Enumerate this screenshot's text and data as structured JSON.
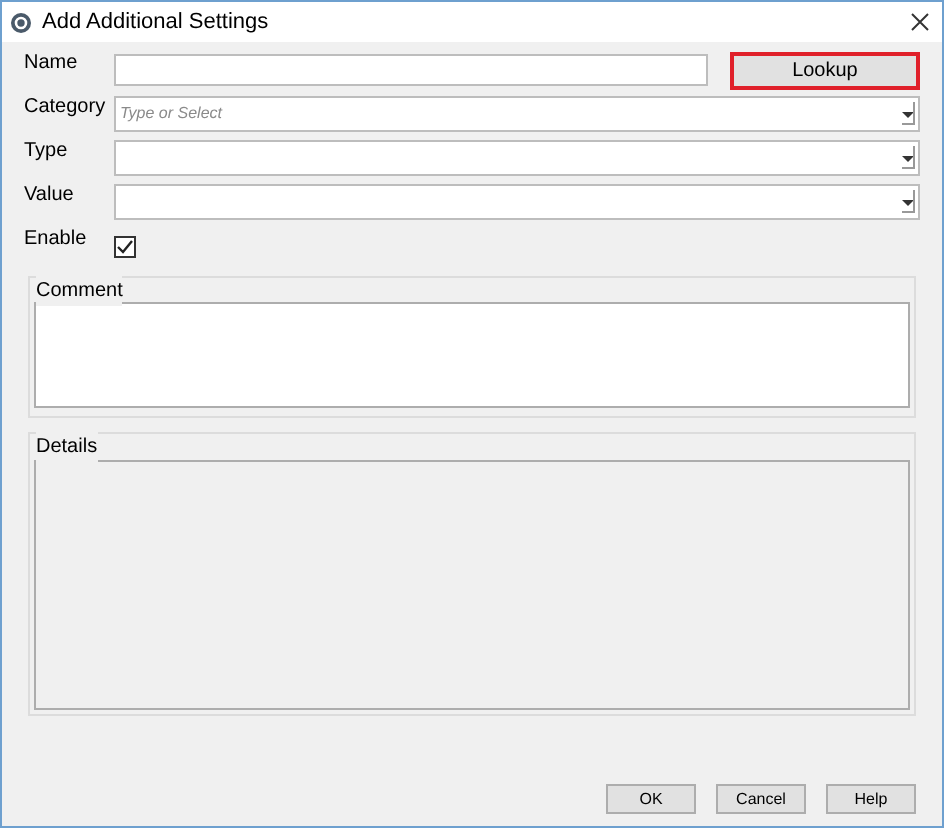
{
  "window": {
    "title": "Add Additional Settings"
  },
  "fields": [
    {
      "kind": "text",
      "label": "Name",
      "button": {
        "label": "Lookup",
        "focused": true
      }
    },
    {
      "kind": "combo",
      "label": "Category",
      "placeholder": "Type or Select"
    },
    {
      "kind": "combo",
      "label": "Type"
    },
    {
      "kind": "combo",
      "label": "Value"
    },
    {
      "kind": "checkbox",
      "label": "Enable",
      "checked": true
    }
  ],
  "comment": {
    "title": "Comment"
  },
  "details": {
    "title": "Details"
  },
  "buttons": [
    "OK",
    "Cancel",
    "Help"
  ]
}
